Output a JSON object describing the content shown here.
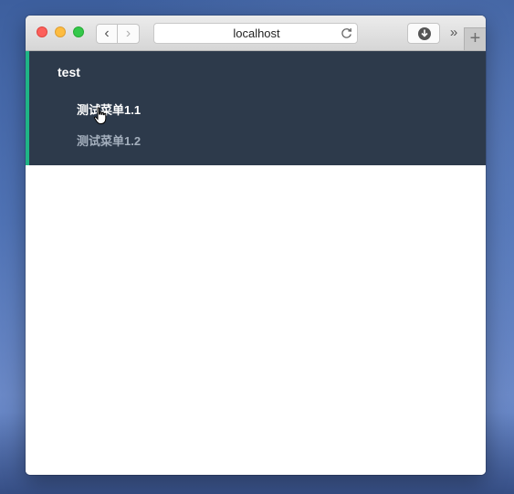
{
  "browser": {
    "address": "localhost",
    "back_glyph": "‹",
    "forward_glyph": "›",
    "overflow_glyph": "»",
    "newtab_glyph": "+"
  },
  "menu": {
    "title": "test",
    "items": [
      {
        "label": "测试菜单1.1",
        "state": "hover"
      },
      {
        "label": "测试菜单1.2",
        "state": "normal"
      }
    ]
  },
  "icons": {
    "reload": "reload-icon",
    "download": "download-icon",
    "cursor": "hand-pointer-cursor"
  },
  "colors": {
    "menu_background": "#2d3a4b",
    "menu_accent": "#1fb486",
    "menu_item_inactive": "#a4afbd",
    "menu_item_active": "#ffffff"
  }
}
